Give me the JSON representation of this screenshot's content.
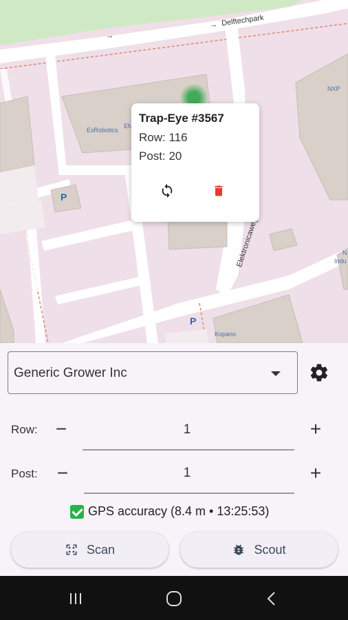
{
  "map": {
    "street_top": "Delftechpark",
    "street_side": "Elektronicaweg",
    "poi_1": "ExRobotics",
    "poi_2": "NXP",
    "poi_3": "Kopano",
    "poi_4": "Indu",
    "poi_5": "EN",
    "poi_6": "N"
  },
  "popup": {
    "title": "Trap-Eye #3567",
    "row_line": "Row: 116",
    "post_line": "Post: 20",
    "refresh_icon": "refresh-icon",
    "delete_icon": "delete-icon"
  },
  "grower_select": {
    "value": "Generic Grower Inc"
  },
  "row": {
    "label": "Row:",
    "value": "1",
    "minus": "−",
    "plus": "+"
  },
  "post": {
    "label": "Post:",
    "value": "1",
    "minus": "−",
    "plus": "+"
  },
  "gps": {
    "text": "GPS accuracy (8.4 m • 13:25:53)"
  },
  "buttons": {
    "scan_label": "Scan",
    "scout_label": "Scout"
  },
  "colors": {
    "accent": "#3b4a5a",
    "check": "#27b24a",
    "delete": "#e53935",
    "marker": "#2ea84a"
  }
}
